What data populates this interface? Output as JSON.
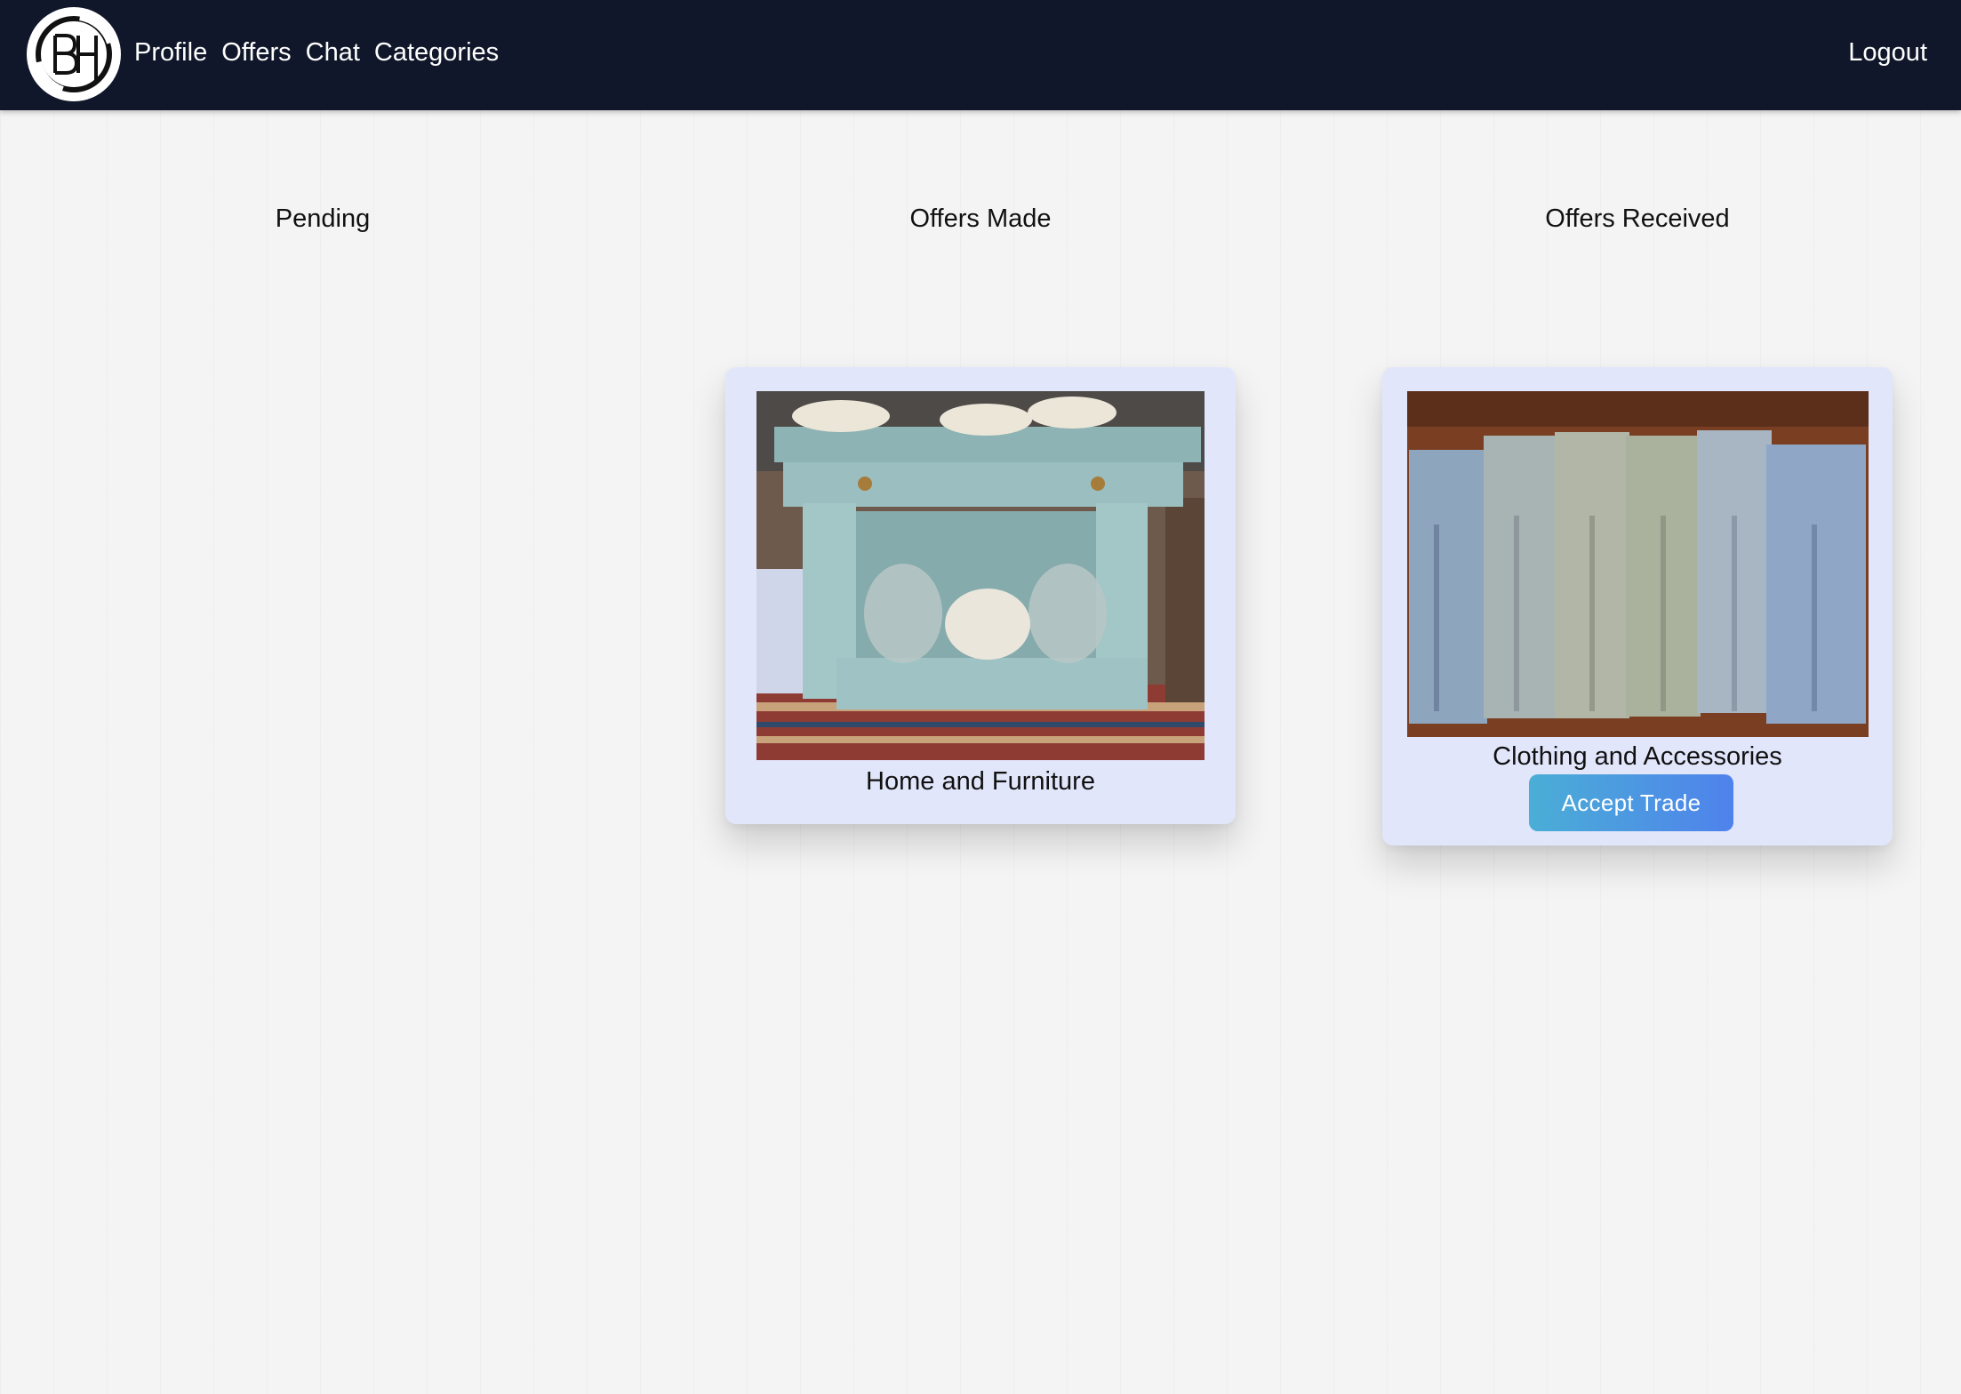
{
  "nav": {
    "logo_icon": "bh-logo-icon",
    "links": [
      "Profile",
      "Offers",
      "Chat",
      "Categories"
    ],
    "logout": "Logout",
    "background": "#10172a"
  },
  "columns": {
    "pending": "Pending",
    "offers_made": "Offers Made",
    "offers_received": "Offers Received"
  },
  "offers_made": [
    {
      "category": "Home and Furniture",
      "image": "blue-console-table-photo"
    }
  ],
  "offers_received": [
    {
      "category": "Clothing and Accessories",
      "image": "denim-jeans-photo",
      "action": "Accept Trade"
    }
  ],
  "colors": {
    "card_bg": "#e2e6fb",
    "button_start": "#4aaed6",
    "button_end": "#4f82ec",
    "page_bg": "#f4f4f4"
  }
}
